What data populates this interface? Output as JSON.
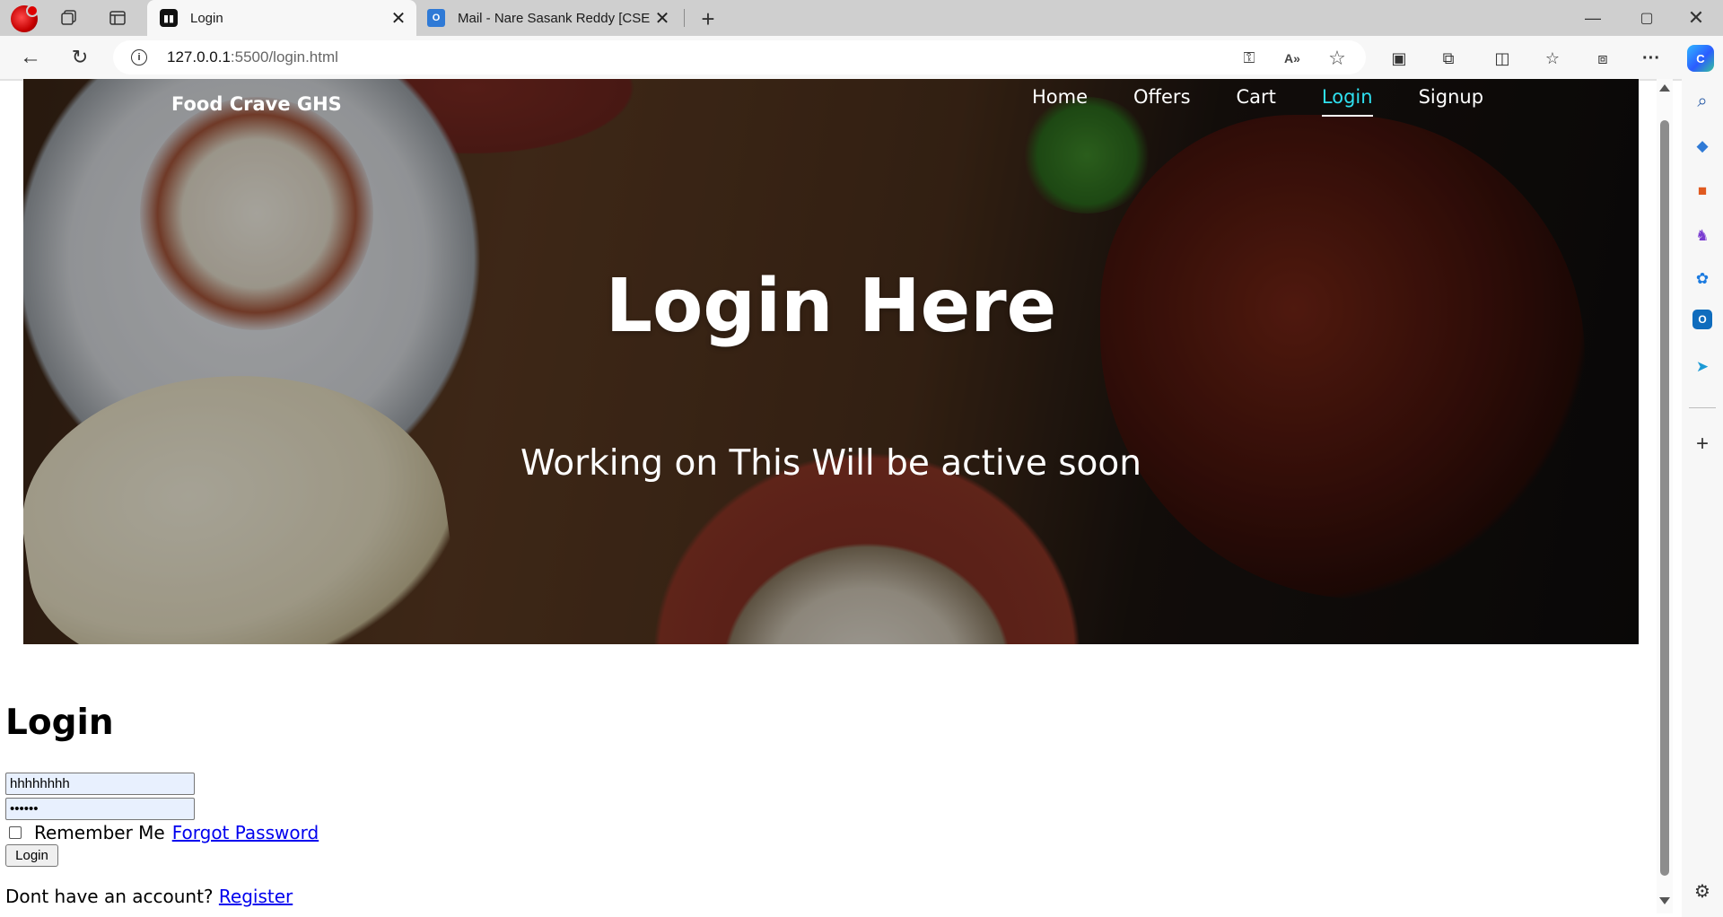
{
  "browser": {
    "tabs": [
      {
        "title": "Login",
        "favicon": "site-favicon"
      },
      {
        "title": "Mail - Nare Sasank Reddy [CSE -",
        "favicon": "outlook-favicon"
      }
    ],
    "url_host": "127.0.0.1",
    "url_path": ":5500/login.html",
    "window_controls": {
      "minimize": "—",
      "maximize": "▢",
      "close": "✕"
    }
  },
  "site": {
    "brand": "Food Crave GHS",
    "nav": [
      {
        "label": "Home",
        "active": false
      },
      {
        "label": "Offers",
        "active": false
      },
      {
        "label": "Cart",
        "active": false
      },
      {
        "label": "Login",
        "active": true
      },
      {
        "label": "Signup",
        "active": false
      }
    ],
    "active_nav_color": "#2fe0f0"
  },
  "hero": {
    "title": "Login Here",
    "subtitle": "Working on This Will be active soon"
  },
  "login_form": {
    "heading": "Login",
    "username_value": "hhhhhhhh",
    "password_value": "••••••",
    "remember_label": "Remember Me",
    "remember_checked": false,
    "forgot_link": "Forgot Password",
    "submit_label": "Login",
    "register_prompt": "Dont have an account?",
    "register_link": "Register"
  },
  "colors": {
    "link": "#0000ee",
    "autofill_bg": "#e8f0fe"
  }
}
